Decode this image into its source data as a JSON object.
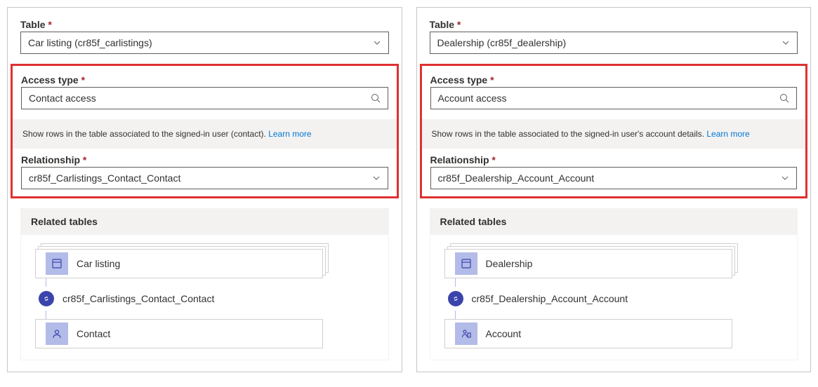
{
  "panels": [
    {
      "labels": {
        "table": "Table",
        "accessType": "Access type",
        "relationship": "Relationship",
        "relatedTables": "Related tables"
      },
      "table": "Car listing (cr85f_carlistings)",
      "accessType": "Contact access",
      "helperText": "Show rows in the table associated to the signed-in user (contact).",
      "learnMore": "Learn more",
      "relationship": "cr85f_Carlistings_Contact_Contact",
      "related": {
        "top": "Car listing",
        "link": "cr85f_Carlistings_Contact_Contact",
        "bottom": "Contact",
        "bottomIcon": "person"
      }
    },
    {
      "labels": {
        "table": "Table",
        "accessType": "Access type",
        "relationship": "Relationship",
        "relatedTables": "Related tables"
      },
      "table": "Dealership (cr85f_dealership)",
      "accessType": "Account access",
      "helperText": "Show rows in the table associated to the signed-in user's account details.",
      "learnMore": "Learn more",
      "relationship": "cr85f_Dealership_Account_Account",
      "related": {
        "top": "Dealership",
        "link": "cr85f_Dealership_Account_Account",
        "bottom": "Account",
        "bottomIcon": "building"
      }
    }
  ]
}
